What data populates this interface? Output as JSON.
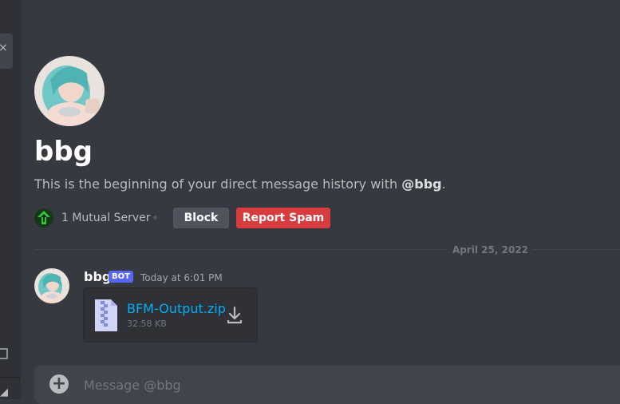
{
  "user": {
    "name": "bbg",
    "handle": "@bbg"
  },
  "intro": {
    "prefix": "This is the beginning of your direct message history with ",
    "suffix": "."
  },
  "mutual": {
    "label": "1 Mutual Server"
  },
  "actions": {
    "block_label": "Block",
    "report_label": "Report Spam"
  },
  "date_divider": "April 25, 2022",
  "message": {
    "author": "bbg",
    "badge": "BOT",
    "timestamp": "Today at 6:01 PM",
    "attachment": {
      "name": "BFM-Output.zip",
      "size": "32.58 KB"
    }
  },
  "composer": {
    "placeholder": "Message @bbg"
  },
  "colors": {
    "background": "#36393f",
    "danger": "#d83c3e",
    "brand": "#5865f2",
    "link": "#00aff4"
  },
  "icons": [
    "close-icon",
    "server-icon",
    "zip-file-icon",
    "download-icon",
    "add-circle-icon"
  ]
}
